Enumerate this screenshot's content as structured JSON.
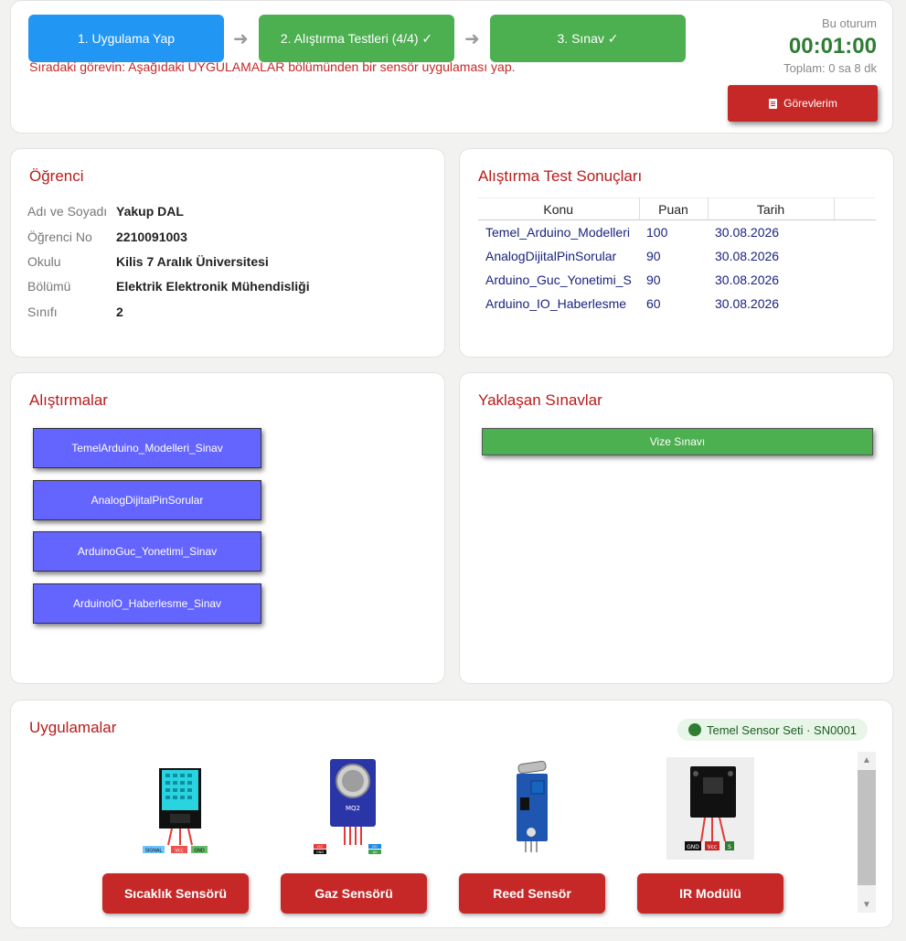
{
  "steps": [
    {
      "label": "1. Uygulama Yap",
      "color": "#2196f3"
    },
    {
      "label": "2. Alıştırma Testleri (4/4) ✓",
      "color": "#4caf50"
    },
    {
      "label": "3. Sınav ✓",
      "color": "#4caf50"
    }
  ],
  "next_task": "Sıradaki görevin: Aşağıdaki UYGULAMALAR bölümünden bir sensör uygulaması yap.",
  "session": {
    "label": "Bu oturum",
    "time": "00:01:00",
    "total": "Toplam: 0 sa 8 dk"
  },
  "tasks_button": "Görevlerim",
  "student": {
    "title": "Öğrenci",
    "rows": [
      {
        "key": "Adı ve Soyadı",
        "value": "Yakup DAL"
      },
      {
        "key": "Öğrenci No",
        "value": "2210091003"
      },
      {
        "key": "Okulu",
        "value": "Kilis 7 Aralık Üniversitesi"
      },
      {
        "key": "Bölümü",
        "value": "Elektrik Elektronik Mühendisliği"
      },
      {
        "key": "Sınıfı",
        "value": "2"
      }
    ]
  },
  "results": {
    "title": "Alıştırma Test Sonuçları",
    "headers": [
      "Konu",
      "Puan",
      "Tarih"
    ],
    "rows": [
      [
        "Temel_Arduino_Modelleri",
        "100",
        "30.08.2026"
      ],
      [
        "AnalogDijitalPinSorular",
        "90",
        "30.08.2026"
      ],
      [
        "Arduino_Guc_Yonetimi_S",
        "90",
        "30.08.2026"
      ],
      [
        "Arduino_IO_Haberlesme",
        "60",
        "30.08.2026"
      ]
    ]
  },
  "exercises": {
    "title": "Alıştırmalar",
    "items": [
      "TemelArduino_Modelleri_Sinav",
      "AnalogDijitalPinSorular",
      "ArduinoGuc_Yonetimi_Sinav",
      "ArduinoIO_Haberlesme_Sinav"
    ]
  },
  "exams": {
    "title": "Yaklaşan Sınavlar",
    "items": [
      "Vize Sınavı"
    ]
  },
  "apps": {
    "title": "Uygulamalar",
    "badge": "Temel Sensor Seti · SN0001",
    "items": [
      {
        "label": "Sıcaklık Sensörü",
        "pins": [
          "SIGNAL",
          "Vcc",
          "GND"
        ]
      },
      {
        "label": "Gaz Sensörü",
        "module_text": "MQ2",
        "pins": [
          "VCC",
          "GND",
          "DO",
          "AO"
        ]
      },
      {
        "label": "Reed Sensör"
      },
      {
        "label": "IR Modülü",
        "pins": [
          "GND",
          "Vcc",
          "S"
        ]
      }
    ]
  }
}
